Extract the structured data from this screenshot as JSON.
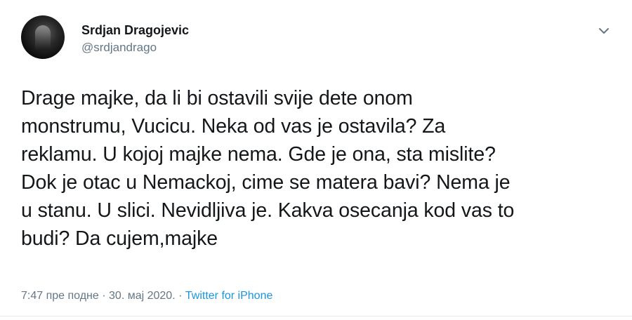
{
  "author": {
    "name": "Srdjan Dragojevic",
    "handle": "@srdjandrago"
  },
  "tweet": {
    "text": "Drage majke, da li bi ostavili svije dete onom\nmonstrumu, Vucicu. Neka od vas je ostavila? Za\nreklamu. U kojoj majke nema. Gde je ona, sta mislite?\nDok je otac u Nemackoj, cime se matera bavi? Nema je\nu stanu. U slici. Nevidljiva je. Kakva osecanja kod vas to\nbudi? Da cujem,majke"
  },
  "meta": {
    "time": "7:47 пре подне",
    "separator": "·",
    "date": "30. мај 2020.",
    "source_separator": "·",
    "source": "Twitter for iPhone"
  },
  "icons": {
    "menu": "chevron-down-icon",
    "avatar": "profile-photo"
  },
  "colors": {
    "text": "#14171a",
    "secondary": "#657786",
    "link": "#1b95e0"
  }
}
